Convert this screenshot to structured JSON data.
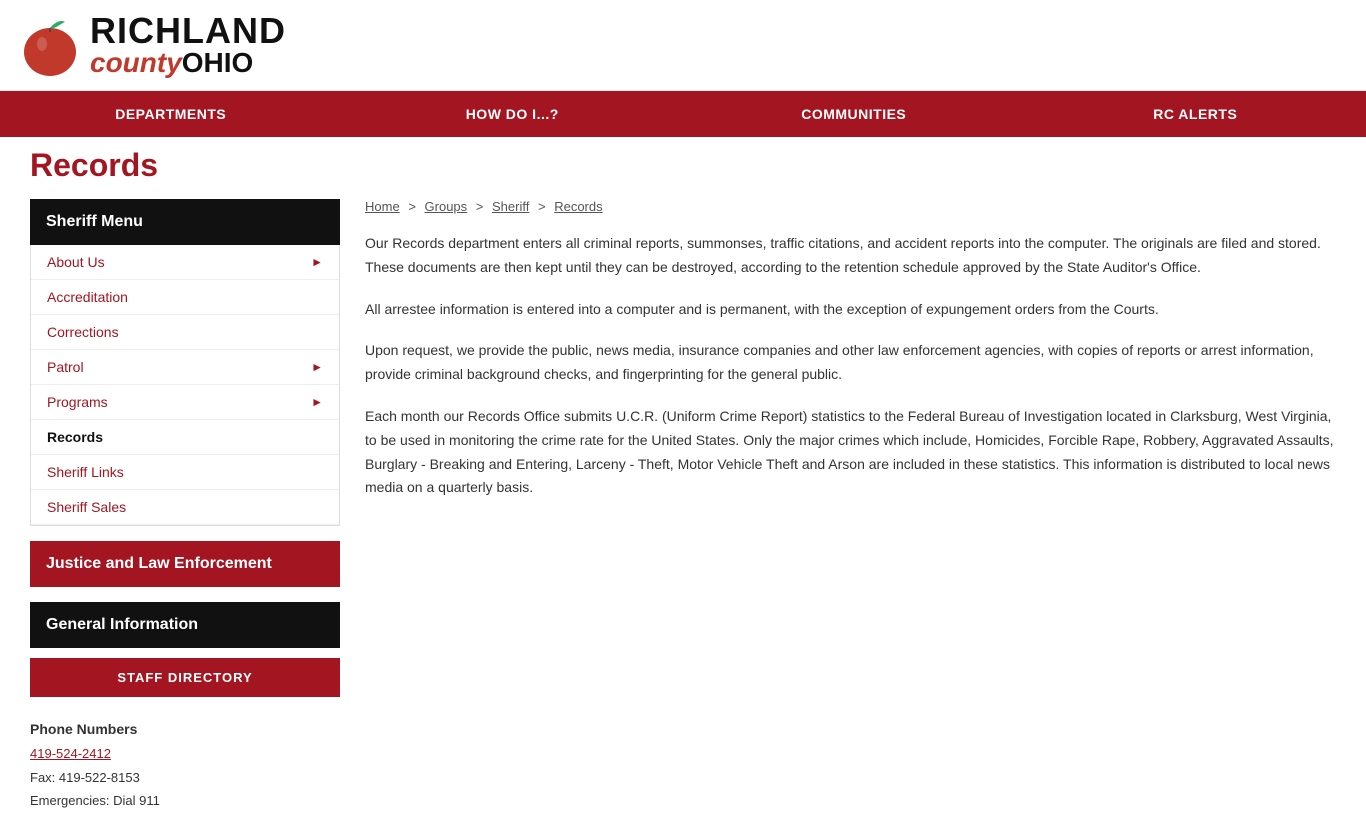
{
  "header": {
    "logo_richland": "RICHLAND",
    "logo_county": "county",
    "logo_ohio": "OHIO"
  },
  "nav": {
    "items": [
      {
        "label": "DEPARTMENTS",
        "href": "#"
      },
      {
        "label": "HOW DO I...?",
        "href": "#"
      },
      {
        "label": "COMMUNITIES",
        "href": "#"
      },
      {
        "label": "RC ALERTS",
        "href": "#"
      }
    ]
  },
  "page": {
    "title": "Records"
  },
  "sidebar": {
    "menu_header": "Sheriff Menu",
    "menu_items": [
      {
        "label": "About Us",
        "has_arrow": true,
        "active": false
      },
      {
        "label": "Accreditation",
        "has_arrow": false,
        "active": false
      },
      {
        "label": "Corrections",
        "has_arrow": false,
        "active": false
      },
      {
        "label": "Patrol",
        "has_arrow": true,
        "active": false
      },
      {
        "label": "Programs",
        "has_arrow": true,
        "active": false
      },
      {
        "label": "Records",
        "has_arrow": false,
        "active": true
      },
      {
        "label": "Sheriff Links",
        "has_arrow": false,
        "active": false
      },
      {
        "label": "Sheriff Sales",
        "has_arrow": false,
        "active": false
      }
    ],
    "justice_label": "Justice and Law Enforcement",
    "general_info_header": "General Information",
    "staff_directory_label": "STAFF DIRECTORY",
    "phone_label": "Phone Numbers",
    "phone_number": "419-524-2412",
    "fax": "Fax: 419-522-8153",
    "emergencies": "Emergencies: Dial 911"
  },
  "breadcrumb": {
    "home": "Home",
    "groups": "Groups",
    "sheriff": "Sheriff",
    "records": "Records"
  },
  "content": {
    "paragraphs": [
      "Our Records department enters all criminal reports, summonses, traffic citations, and accident reports into the computer. The originals are filed and stored. These documents are then kept until they can be destroyed, according to the retention schedule approved by the State Auditor's Office.",
      "All arrestee information is entered into a computer and is permanent, with the exception of expungement orders from the Courts.",
      "Upon request, we provide the public, news media, insurance companies and other law enforcement agencies, with copies of reports or arrest information, provide criminal background checks, and fingerprinting for the general public.",
      "Each month our Records Office submits U.C.R. (Uniform Crime Report) statistics to the Federal Bureau of Investigation located in Clarksburg, West Virginia, to be used in monitoring the crime rate for the United States. Only the major crimes which include, Homicides, Forcible Rape, Robbery, Aggravated Assaults, Burglary - Breaking and Entering, Larceny - Theft, Motor Vehicle Theft and Arson are included in these statistics. This information is distributed to local news media on a quarterly basis."
    ]
  }
}
